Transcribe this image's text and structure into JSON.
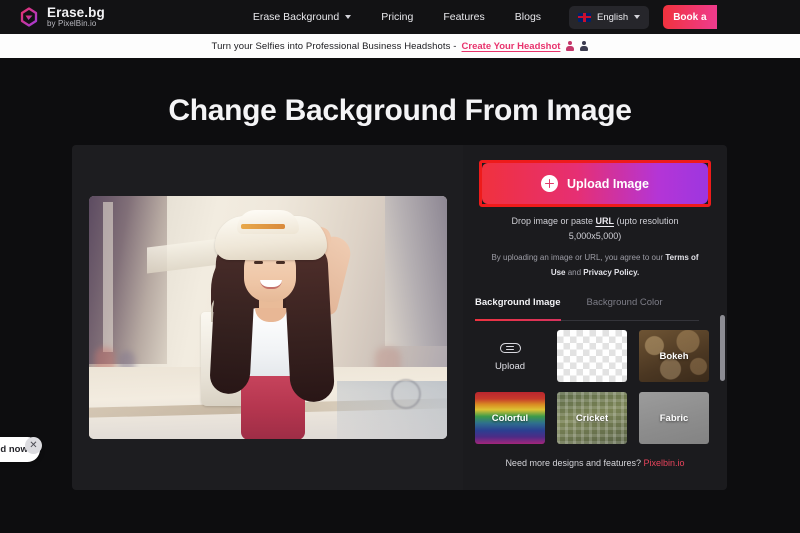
{
  "brand": {
    "name": "Erase.bg",
    "tagline": "by PixelBin.io",
    "logo_icon": "erase-bg-logo"
  },
  "nav": {
    "items": [
      {
        "label": "Erase Background",
        "has_dropdown": true
      },
      {
        "label": "Pricing",
        "has_dropdown": false
      },
      {
        "label": "Features",
        "has_dropdown": false
      },
      {
        "label": "Blogs",
        "has_dropdown": false
      }
    ],
    "language": {
      "label": "English",
      "flag": "uk-flag-icon",
      "chevron": "chevron-down-icon"
    },
    "cta": {
      "label": "Book a"
    }
  },
  "banner": {
    "text": "Turn your Selfies into Professional Business Headshots -",
    "link": "Create Your Headshot",
    "icons": [
      "person-pink-icon",
      "person-dark-icon"
    ]
  },
  "page": {
    "title": "Change Background From Image"
  },
  "preview": {
    "image_alt": "Woman in white hat holding shopping bags on a city street"
  },
  "tools": {
    "upload": {
      "button_label": "Upload Image",
      "plus_icon": "plus-circle-icon",
      "highlight_color": "#ee1b1b",
      "gradient_from": "#f0313e",
      "gradient_to": "#9d36e0"
    },
    "drop_hint_prefix": "Drop image or paste ",
    "drop_hint_link": "URL",
    "drop_hint_suffix": " (upto resolution",
    "drop_hint_line2": "5,000x5,000)",
    "terms": {
      "line1_prefix": "By uploading an image or URL, you agree to our ",
      "line1_bold": "Terms of",
      "line2_bold1": "Use",
      "line2_mid": " and ",
      "line2_bold2": "Privacy Policy."
    },
    "tabs": [
      {
        "label": "Background Image",
        "active": true
      },
      {
        "label": "Background Color",
        "active": false
      }
    ],
    "thumbnails": [
      {
        "label": "Upload",
        "kind": "upload",
        "icon": "cloud-upload-icon"
      },
      {
        "label": "",
        "kind": "transparent"
      },
      {
        "label": "Bokeh",
        "kind": "bokeh"
      },
      {
        "label": "Colorful",
        "kind": "colorful"
      },
      {
        "label": "Cricket",
        "kind": "cricket"
      },
      {
        "label": "Fabric",
        "kind": "fabric"
      }
    ],
    "footer_text": "Need more designs and features? ",
    "footer_link": "Pixelbin.io"
  },
  "chat": {
    "text": "d now!",
    "close_icon": "close-icon"
  }
}
